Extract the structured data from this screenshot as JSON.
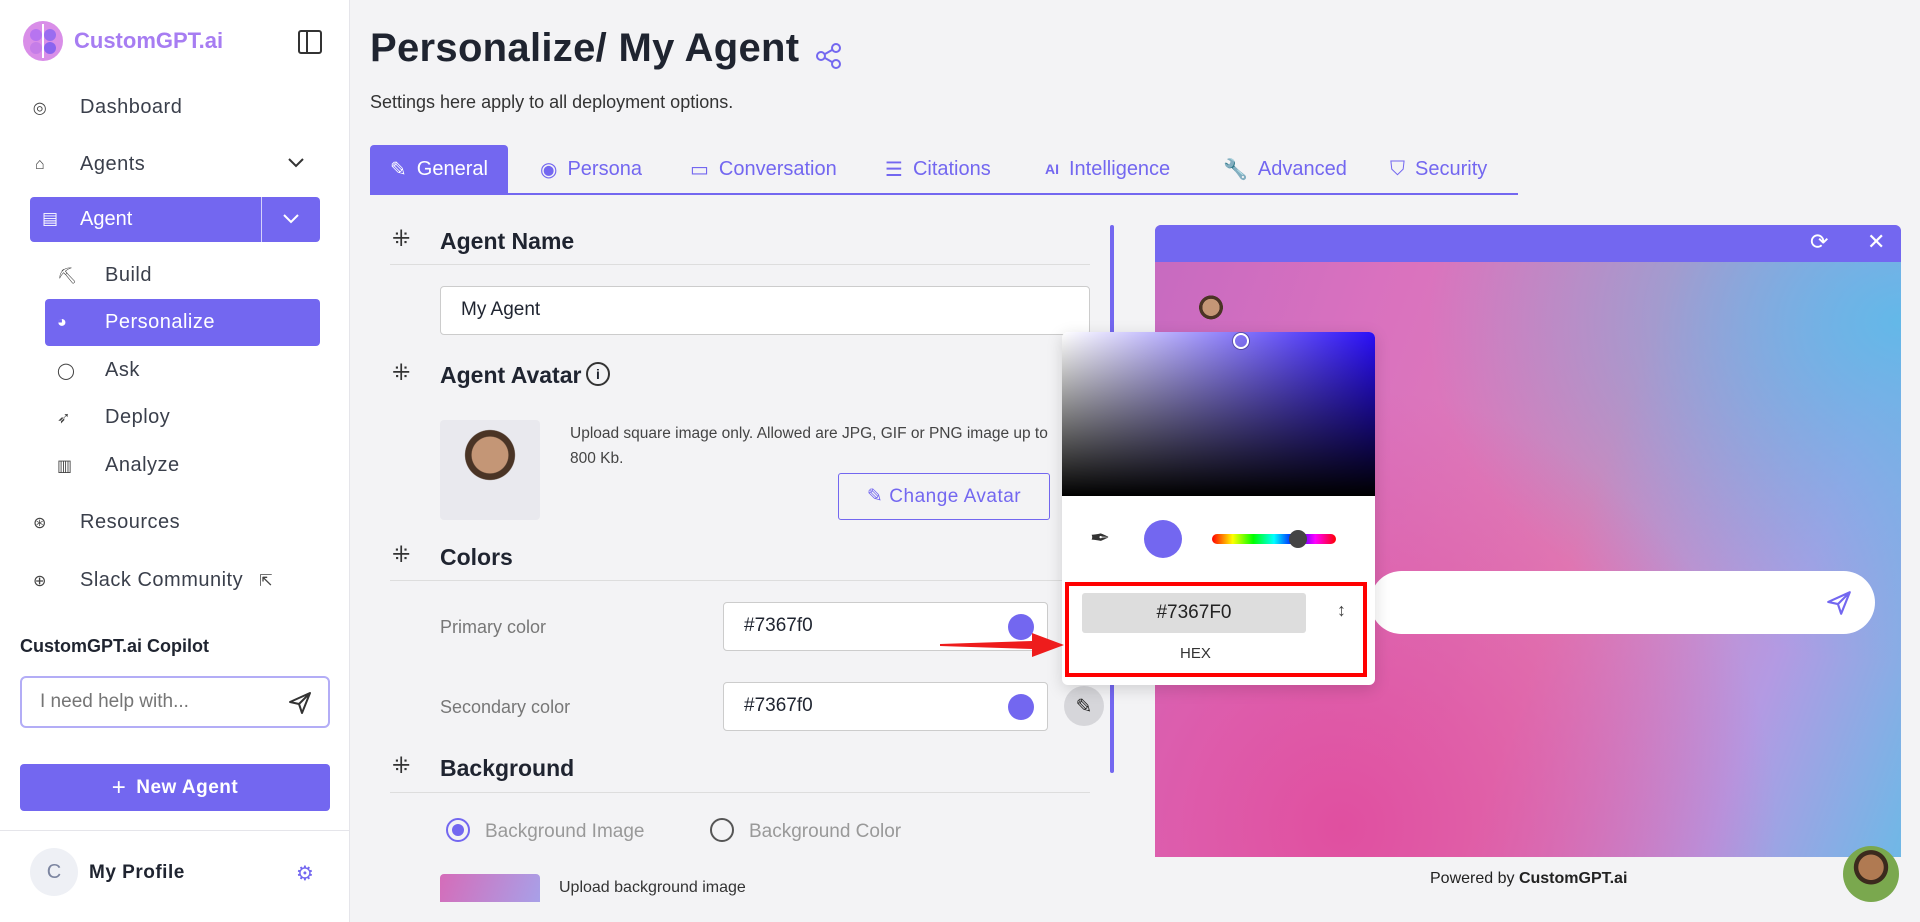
{
  "brand": {
    "name": "CustomGPT.ai"
  },
  "sidebar": {
    "nav": [
      {
        "label": "Dashboard",
        "icon": "dashboard-icon"
      },
      {
        "label": "Agents",
        "icon": "home-icon"
      }
    ],
    "agent": {
      "label": "Agent"
    },
    "sub_items": [
      {
        "label": "Build",
        "icon": "build-icon"
      },
      {
        "label": "Personalize",
        "icon": "palette-icon"
      },
      {
        "label": "Ask",
        "icon": "chat-icon"
      },
      {
        "label": "Deploy",
        "icon": "rocket-icon"
      },
      {
        "label": "Analyze",
        "icon": "bar-chart-icon"
      }
    ],
    "resources": "Resources",
    "slack": "Slack Community",
    "copilot": {
      "title": "CustomGPT.ai Copilot",
      "placeholder": "I need help with..."
    },
    "new_agent": "New Agent",
    "profile": {
      "initial": "C",
      "name": "My Profile"
    }
  },
  "header": {
    "title": "Personalize/ My Agent",
    "subtitle": "Settings here apply to all deployment options."
  },
  "tabs": [
    "General",
    "Persona",
    "Conversation",
    "Citations",
    "Intelligence",
    "Advanced",
    "Security"
  ],
  "sections": {
    "agent_name": {
      "title": "Agent Name",
      "value": "My Agent"
    },
    "agent_avatar": {
      "title": "Agent Avatar",
      "note": "Upload square image only. Allowed are JPG, GIF or PNG image up to 800 Kb.",
      "button": "Change Avatar"
    },
    "colors": {
      "title": "Colors",
      "primary_label": "Primary color",
      "primary_value": "#7367f0",
      "secondary_label": "Secondary color",
      "secondary_value": "#7367f0"
    },
    "background": {
      "title": "Background",
      "option_image": "Background Image",
      "option_color": "Background Color",
      "upload_label": "Upload background image"
    }
  },
  "color_picker": {
    "hex_value": "#7367F0",
    "mode_label": "HEX",
    "selected_color": "#7367f0"
  },
  "preview": {
    "powered_prefix": "Powered by ",
    "powered_brand": "CustomGPT.ai"
  },
  "colors": {
    "accent": "#7367f0",
    "highlight": "#ff0000"
  }
}
